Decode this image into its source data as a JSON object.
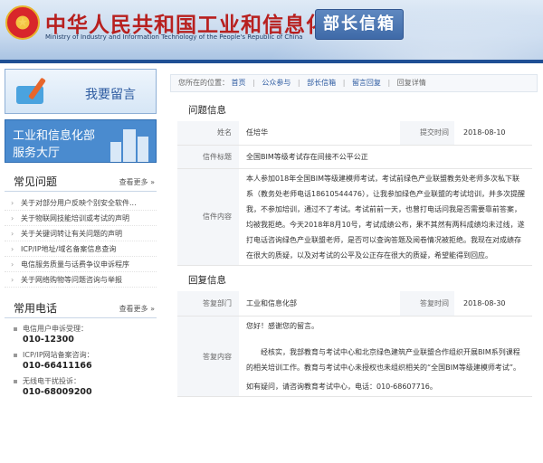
{
  "header": {
    "title": "中华人民共和国工业和信息化部",
    "subtitle": "Ministry of Industry and Information Technology of the People's Republic of China",
    "mailbox": "部长信箱",
    "colors": {
      "title_red": "#b8201f",
      "brand_blue": "#1f4f94"
    }
  },
  "sidebar": {
    "leave_message": "我要留言",
    "service_hall_line1": "工业和信息化部",
    "service_hall_line2": "服务大厅",
    "faq_title": "常见问题",
    "faq_more": "查看更多 »",
    "faq_items": [
      "关于对部分用户反映个别安全软件...",
      "关于物联网技能培训或考试的声明",
      "关于关键词转让有关问题的声明",
      "ICP/IP地址/域名备案信息查询",
      "电信服务质量与话费争议申诉程序",
      "关于网络购物等问题咨询与举报"
    ],
    "phone_title": "常用电话",
    "phone_more": "查看更多 »",
    "phones": [
      {
        "label": "电信用户申诉受理：",
        "number": "010-12300"
      },
      {
        "label": "ICP/IP网站备案咨询：",
        "number": "010-66411166"
      },
      {
        "label": "无线电干扰投诉：",
        "number": "010-68009200"
      }
    ]
  },
  "breadcrumb": {
    "prefix": "您所在的位置：",
    "items": [
      "首页",
      "公众参与",
      "部长信箱",
      "留言回复",
      "回复详情"
    ]
  },
  "question": {
    "section_title": "问题信息",
    "name_label": "姓名",
    "name_value": "任培华",
    "submit_time_label": "提交时间",
    "submit_time_value": "2018-08-10",
    "letter_title_label": "信件标题",
    "letter_title_value": "全国BIM等级考试存在间接不公平公正",
    "content_label": "信件内容",
    "content_value": "本人参加018年全国BIM等级建模师考试，考试前绿色产业联盟教务处老师多次私下联系（教务处老师电话18610544476），让我参加绿色产业联盟的考试培训，并多次提醒我，不参加培训，通过不了考试。考试前前一天，也曾打电话问我是否需要靠前答案，均被我拒绝。今天2018年8月10号，考试成绩公布，果不其然有两科成绩均未过线，遂打电话咨询绿色产业联盟老师，是否可以查询答题及阅卷情况被拒绝。我现在对成绩存在很大的质疑，以及对考试的公平及公正存在很大的质疑，希望能得到回应。"
  },
  "reply": {
    "section_title": "回复信息",
    "dept_label": "答复部门",
    "dept_value": "工业和信息化部",
    "time_label": "答复时间",
    "time_value": "2018-08-30",
    "content_label": "答复内容",
    "para1": "您好！感谢您的留言。",
    "para2": "经核实，我部教育与考试中心和北京绿色建筑产业联盟合作组织开展BIM系列课程的相关培训工作。教育与考试中心未授权也未组织相关的“全国BIM等级建模师考试”。",
    "para3": "如有疑问，请咨询教育考试中心，电话：010-68607716。"
  }
}
